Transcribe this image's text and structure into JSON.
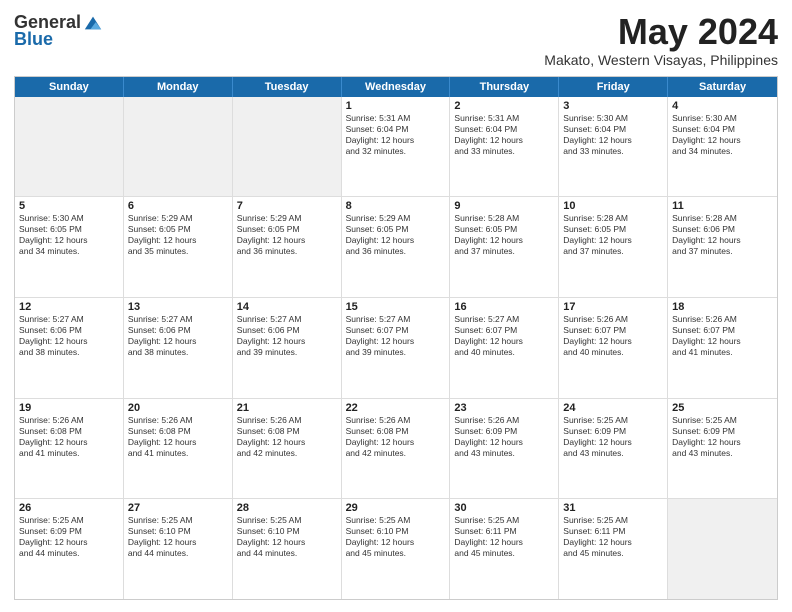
{
  "logo": {
    "general": "General",
    "blue": "Blue"
  },
  "header": {
    "month": "May 2024",
    "location": "Makato, Western Visayas, Philippines"
  },
  "days": [
    "Sunday",
    "Monday",
    "Tuesday",
    "Wednesday",
    "Thursday",
    "Friday",
    "Saturday"
  ],
  "weeks": [
    [
      {
        "day": "",
        "lines": []
      },
      {
        "day": "",
        "lines": []
      },
      {
        "day": "",
        "lines": []
      },
      {
        "day": "1",
        "lines": [
          "Sunrise: 5:31 AM",
          "Sunset: 6:04 PM",
          "Daylight: 12 hours",
          "and 32 minutes."
        ]
      },
      {
        "day": "2",
        "lines": [
          "Sunrise: 5:31 AM",
          "Sunset: 6:04 PM",
          "Daylight: 12 hours",
          "and 33 minutes."
        ]
      },
      {
        "day": "3",
        "lines": [
          "Sunrise: 5:30 AM",
          "Sunset: 6:04 PM",
          "Daylight: 12 hours",
          "and 33 minutes."
        ]
      },
      {
        "day": "4",
        "lines": [
          "Sunrise: 5:30 AM",
          "Sunset: 6:04 PM",
          "Daylight: 12 hours",
          "and 34 minutes."
        ]
      }
    ],
    [
      {
        "day": "5",
        "lines": [
          "Sunrise: 5:30 AM",
          "Sunset: 6:05 PM",
          "Daylight: 12 hours",
          "and 34 minutes."
        ]
      },
      {
        "day": "6",
        "lines": [
          "Sunrise: 5:29 AM",
          "Sunset: 6:05 PM",
          "Daylight: 12 hours",
          "and 35 minutes."
        ]
      },
      {
        "day": "7",
        "lines": [
          "Sunrise: 5:29 AM",
          "Sunset: 6:05 PM",
          "Daylight: 12 hours",
          "and 36 minutes."
        ]
      },
      {
        "day": "8",
        "lines": [
          "Sunrise: 5:29 AM",
          "Sunset: 6:05 PM",
          "Daylight: 12 hours",
          "and 36 minutes."
        ]
      },
      {
        "day": "9",
        "lines": [
          "Sunrise: 5:28 AM",
          "Sunset: 6:05 PM",
          "Daylight: 12 hours",
          "and 37 minutes."
        ]
      },
      {
        "day": "10",
        "lines": [
          "Sunrise: 5:28 AM",
          "Sunset: 6:05 PM",
          "Daylight: 12 hours",
          "and 37 minutes."
        ]
      },
      {
        "day": "11",
        "lines": [
          "Sunrise: 5:28 AM",
          "Sunset: 6:06 PM",
          "Daylight: 12 hours",
          "and 37 minutes."
        ]
      }
    ],
    [
      {
        "day": "12",
        "lines": [
          "Sunrise: 5:27 AM",
          "Sunset: 6:06 PM",
          "Daylight: 12 hours",
          "and 38 minutes."
        ]
      },
      {
        "day": "13",
        "lines": [
          "Sunrise: 5:27 AM",
          "Sunset: 6:06 PM",
          "Daylight: 12 hours",
          "and 38 minutes."
        ]
      },
      {
        "day": "14",
        "lines": [
          "Sunrise: 5:27 AM",
          "Sunset: 6:06 PM",
          "Daylight: 12 hours",
          "and 39 minutes."
        ]
      },
      {
        "day": "15",
        "lines": [
          "Sunrise: 5:27 AM",
          "Sunset: 6:07 PM",
          "Daylight: 12 hours",
          "and 39 minutes."
        ]
      },
      {
        "day": "16",
        "lines": [
          "Sunrise: 5:27 AM",
          "Sunset: 6:07 PM",
          "Daylight: 12 hours",
          "and 40 minutes."
        ]
      },
      {
        "day": "17",
        "lines": [
          "Sunrise: 5:26 AM",
          "Sunset: 6:07 PM",
          "Daylight: 12 hours",
          "and 40 minutes."
        ]
      },
      {
        "day": "18",
        "lines": [
          "Sunrise: 5:26 AM",
          "Sunset: 6:07 PM",
          "Daylight: 12 hours",
          "and 41 minutes."
        ]
      }
    ],
    [
      {
        "day": "19",
        "lines": [
          "Sunrise: 5:26 AM",
          "Sunset: 6:08 PM",
          "Daylight: 12 hours",
          "and 41 minutes."
        ]
      },
      {
        "day": "20",
        "lines": [
          "Sunrise: 5:26 AM",
          "Sunset: 6:08 PM",
          "Daylight: 12 hours",
          "and 41 minutes."
        ]
      },
      {
        "day": "21",
        "lines": [
          "Sunrise: 5:26 AM",
          "Sunset: 6:08 PM",
          "Daylight: 12 hours",
          "and 42 minutes."
        ]
      },
      {
        "day": "22",
        "lines": [
          "Sunrise: 5:26 AM",
          "Sunset: 6:08 PM",
          "Daylight: 12 hours",
          "and 42 minutes."
        ]
      },
      {
        "day": "23",
        "lines": [
          "Sunrise: 5:26 AM",
          "Sunset: 6:09 PM",
          "Daylight: 12 hours",
          "and 43 minutes."
        ]
      },
      {
        "day": "24",
        "lines": [
          "Sunrise: 5:25 AM",
          "Sunset: 6:09 PM",
          "Daylight: 12 hours",
          "and 43 minutes."
        ]
      },
      {
        "day": "25",
        "lines": [
          "Sunrise: 5:25 AM",
          "Sunset: 6:09 PM",
          "Daylight: 12 hours",
          "and 43 minutes."
        ]
      }
    ],
    [
      {
        "day": "26",
        "lines": [
          "Sunrise: 5:25 AM",
          "Sunset: 6:09 PM",
          "Daylight: 12 hours",
          "and 44 minutes."
        ]
      },
      {
        "day": "27",
        "lines": [
          "Sunrise: 5:25 AM",
          "Sunset: 6:10 PM",
          "Daylight: 12 hours",
          "and 44 minutes."
        ]
      },
      {
        "day": "28",
        "lines": [
          "Sunrise: 5:25 AM",
          "Sunset: 6:10 PM",
          "Daylight: 12 hours",
          "and 44 minutes."
        ]
      },
      {
        "day": "29",
        "lines": [
          "Sunrise: 5:25 AM",
          "Sunset: 6:10 PM",
          "Daylight: 12 hours",
          "and 45 minutes."
        ]
      },
      {
        "day": "30",
        "lines": [
          "Sunrise: 5:25 AM",
          "Sunset: 6:11 PM",
          "Daylight: 12 hours",
          "and 45 minutes."
        ]
      },
      {
        "day": "31",
        "lines": [
          "Sunrise: 5:25 AM",
          "Sunset: 6:11 PM",
          "Daylight: 12 hours",
          "and 45 minutes."
        ]
      },
      {
        "day": "",
        "lines": []
      }
    ]
  ]
}
